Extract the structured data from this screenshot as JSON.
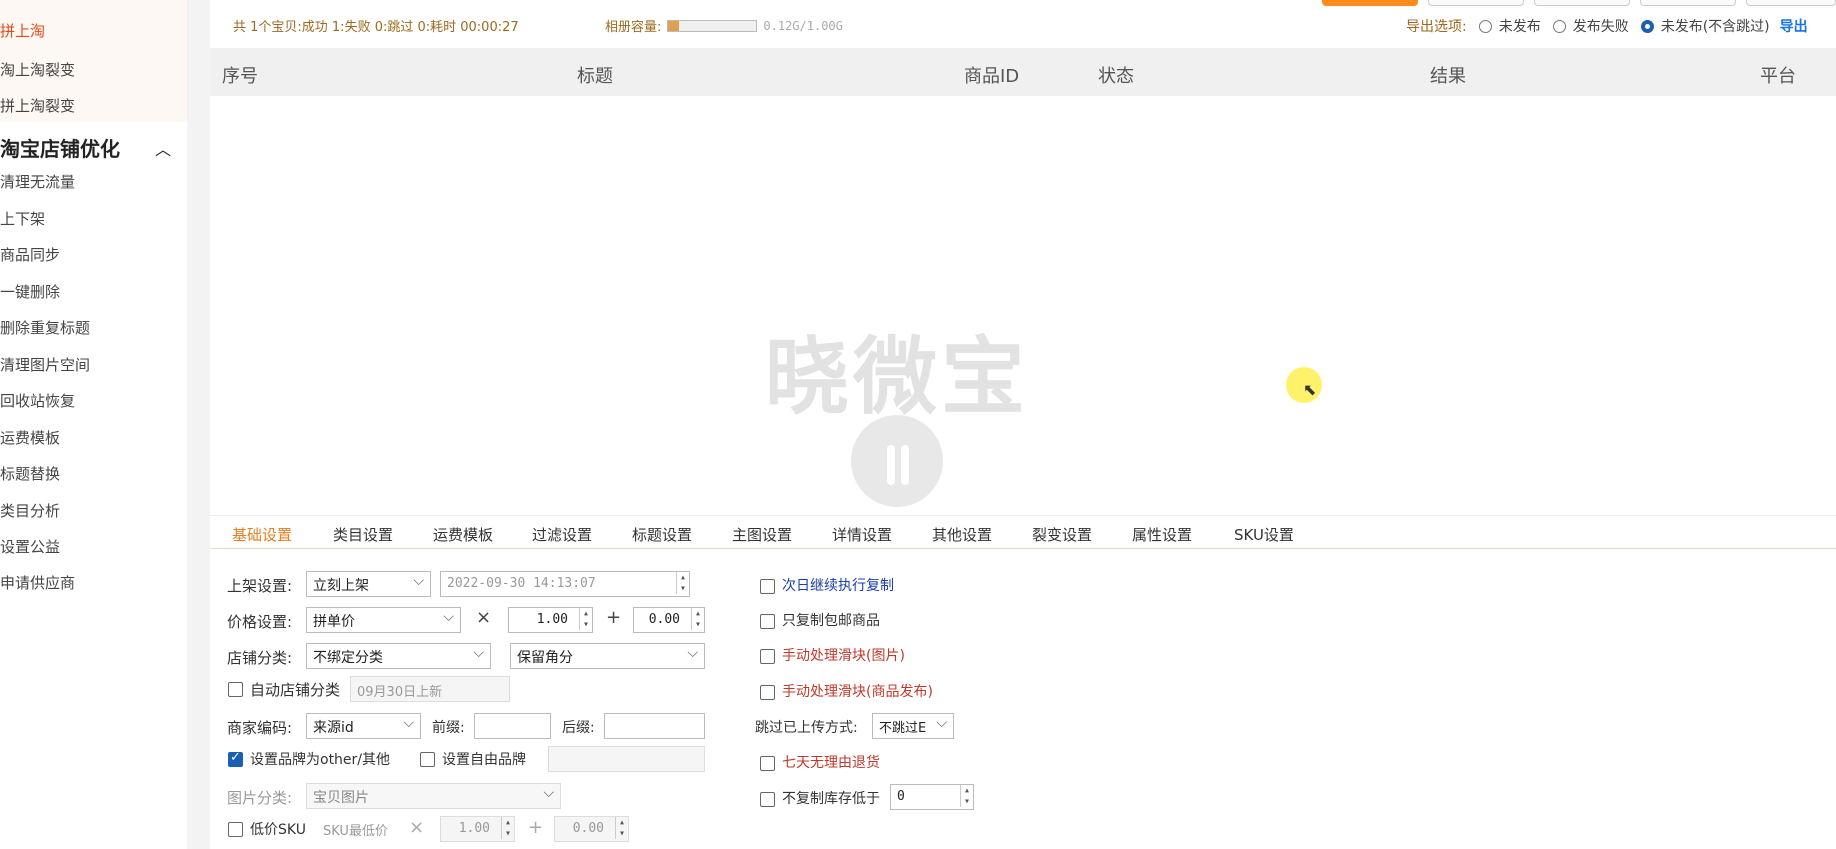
{
  "sidebar": {
    "top_items": [
      {
        "label": "拼上淘",
        "active": true
      },
      {
        "label": "淘上淘裂变",
        "active": false
      },
      {
        "label": "拼上淘裂变",
        "active": false
      }
    ],
    "section_title": "淘宝店铺优化",
    "section_items": [
      "清理无流量",
      "上下架",
      "商品同步",
      "一键删除",
      "删除重复标题",
      "清理图片空间",
      "回收站恢复",
      "运费模板",
      "标题替换",
      "类目分析",
      "设置公益",
      "申请供应商"
    ]
  },
  "stats": {
    "text": "共 1个宝贝:成功 1:失败 0:跳过 0:耗时 00:00:27",
    "album_label": "相册容量:",
    "album_capacity": "0.12G/1.00G",
    "album_fill": 0.12
  },
  "export": {
    "label": "导出选项:",
    "options": [
      "未发布",
      "发布失败",
      "未发布(不含跳过)"
    ],
    "selected_index": 2,
    "link": "导出"
  },
  "table": {
    "columns": [
      "序号",
      "标题",
      "商品ID",
      "状态",
      "结果",
      "平台"
    ]
  },
  "watermark": {
    "text": "晓微宝"
  },
  "tabs": [
    "基础设置",
    "类目设置",
    "运费模板",
    "过滤设置",
    "标题设置",
    "主图设置",
    "详情设置",
    "其他设置",
    "裂变设置",
    "属性设置",
    "SKU设置"
  ],
  "active_tab": 0,
  "settings": {
    "listing": {
      "label": "上架设置:",
      "value": "立刻上架",
      "datetime": "2022-09-30 14:13:07"
    },
    "price": {
      "label": "价格设置:",
      "value": "拼单价",
      "multiply": "×",
      "factor": "1.00",
      "plus": "+",
      "addend": "0.00"
    },
    "store_category": {
      "label": "店铺分类:",
      "value": "不绑定分类",
      "rounding": "保留角分"
    },
    "auto_category": {
      "label": "自动店铺分类",
      "checked": false,
      "value": "09月30日上新"
    },
    "merchant_code": {
      "label": "商家编码:",
      "value": "来源id",
      "prefix_label": "前缀:",
      "prefix": "",
      "suffix_label": "后缀:",
      "suffix": ""
    },
    "brand_other": {
      "label": "设置品牌为other/其他",
      "checked": true
    },
    "brand_free": {
      "label": "设置自由品牌",
      "checked": false,
      "value": ""
    },
    "image_category": {
      "label": "图片分类:",
      "value": "宝贝图片"
    },
    "low_sku": {
      "label": "低价SKU",
      "checked": false,
      "min_label": "SKU最低价",
      "multiply": "×",
      "factor": "1.00",
      "plus": "+",
      "addend": "0.00"
    },
    "right": {
      "next_day": {
        "label": "次日继续执行复制",
        "checked": false
      },
      "free_shipping": {
        "label": "只复制包邮商品",
        "checked": false
      },
      "slider_image": {
        "label": "手动处理滑块(图片)",
        "checked": false
      },
      "slider_publish": {
        "label": "手动处理滑块(商品发布)",
        "checked": false
      },
      "skip_mode": {
        "label": "跳过已上传方式:",
        "value": "不跳过E"
      },
      "seven_day": {
        "label": "七天无理由退货",
        "checked": false
      },
      "min_stock": {
        "label": "不复制库存低于",
        "checked": false,
        "value": "0"
      }
    }
  },
  "colors": {
    "accent": "#e67e22",
    "primary_button": "#ff8c1a",
    "link": "#1a73e8",
    "checkbox": "#1a5fb4",
    "warning": "#c0392b"
  }
}
